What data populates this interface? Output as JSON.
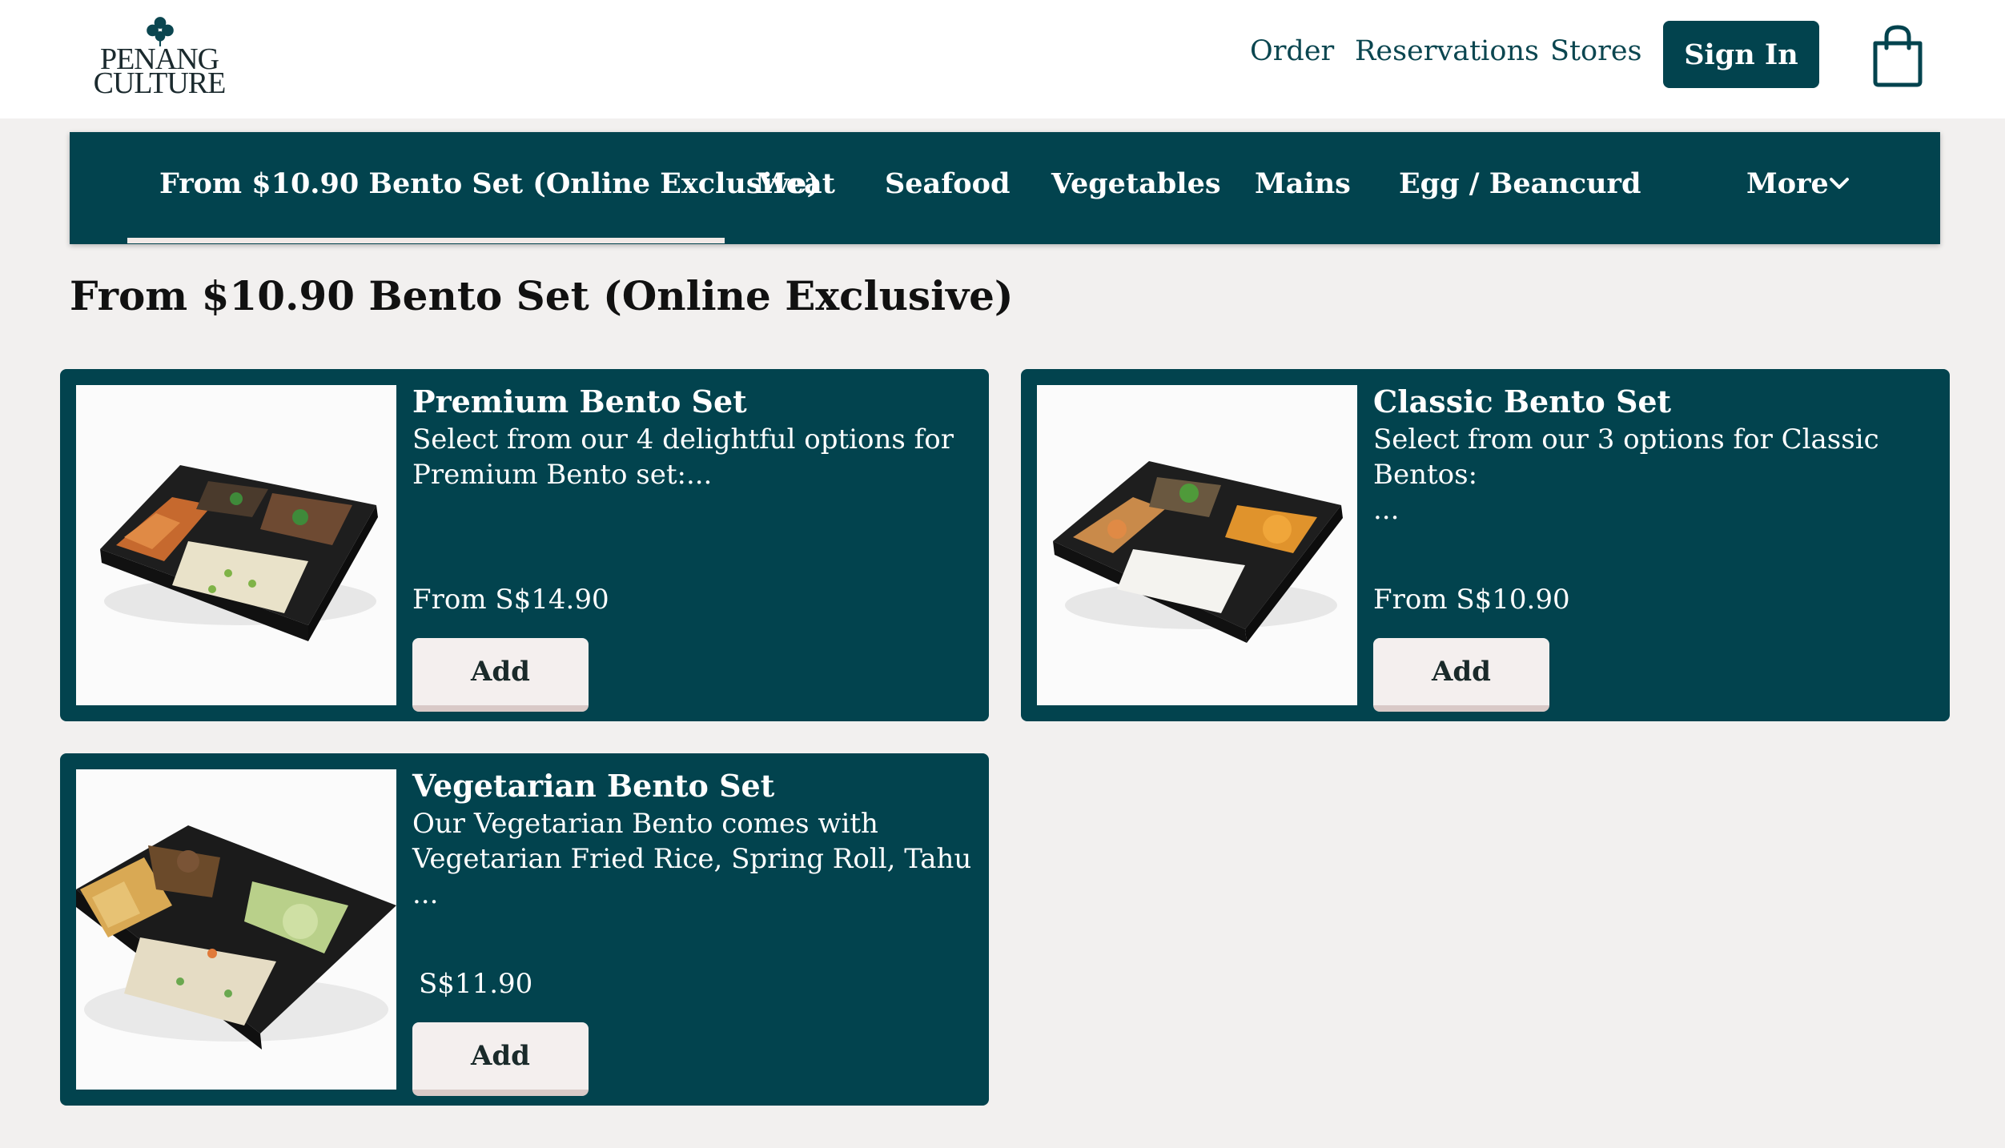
{
  "brand": {
    "line1": "PENANG",
    "line2": "CULTURE"
  },
  "header": {
    "links": [
      "Order",
      "Reservations",
      "Stores"
    ],
    "sign_in": "Sign In"
  },
  "categories": {
    "items": [
      "From $10.90 Bento Set (Online Exclusive)",
      "Meat",
      "Seafood",
      "Vegetables",
      "Mains",
      "Egg / Beancurd"
    ],
    "more": "More",
    "active": 0
  },
  "section": {
    "title": "From $10.90 Bento Set (Online Exclusive)"
  },
  "products": [
    {
      "title": "Premium Bento Set",
      "desc_line1": "Select from our 4 delightful options for",
      "desc_line2": "Premium Bento set:...",
      "price": "From S$14.90",
      "add": "Add"
    },
    {
      "title": "Classic Bento Set",
      "desc_line1": "Select from our 3 options for Classic Bentos:",
      "desc_line2": "...",
      "price": "From S$10.90",
      "add": "Add"
    },
    {
      "title": "Vegetarian Bento Set",
      "desc_line1": "Our Vegetarian Bento comes with",
      "desc_line2": "Vegetarian Fried Rice, Spring Roll, Tahu ...",
      "price": "S$11.90",
      "add": "Add"
    }
  ],
  "colors": {
    "brand_teal": "#02434e",
    "background": "#f2f0ef",
    "button_light": "#f4efee"
  },
  "icons": [
    "clover-logo-icon",
    "shopping-bag-icon",
    "chevron-down-icon"
  ]
}
